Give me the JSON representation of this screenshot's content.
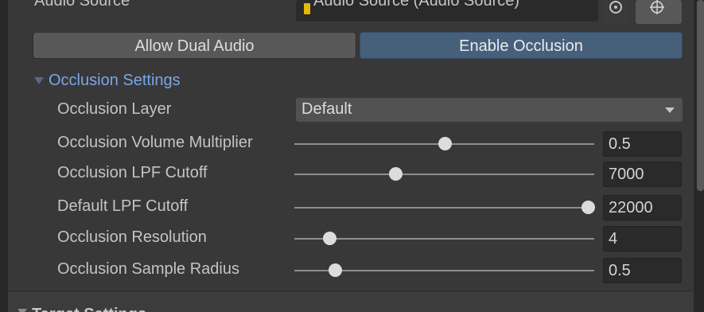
{
  "top": {
    "label": "Audio Source",
    "object_value": "Audio Source (Audio Source)",
    "object_icon": "audio-source-icon",
    "picker_icon": "object-picker-icon",
    "target_icon": "target-icon"
  },
  "buttons": {
    "dual_audio": "Allow Dual Audio",
    "enable_occlusion": "Enable Occlusion"
  },
  "occlusion_settings": {
    "title": "Occlusion Settings",
    "layer": {
      "label": "Occlusion Layer",
      "value": "Default"
    },
    "sliders": [
      {
        "label": "Occlusion Volume Multiplier",
        "value": "0.5",
        "fraction": 0.5
      },
      {
        "label": "Occlusion LPF Cutoff",
        "value": "7000",
        "fraction": 0.33
      },
      {
        "label": "Default LPF Cutoff",
        "value": "22000",
        "fraction": 1.0
      },
      {
        "label": "Occlusion Resolution",
        "value": "4",
        "fraction": 0.1
      },
      {
        "label": "Occlusion Sample Radius",
        "value": "0.5",
        "fraction": 0.12
      }
    ]
  },
  "next_section": {
    "title": "Target Settings"
  },
  "colors": {
    "accent_button": "#46607c",
    "foldout_title": "#7aa6e8",
    "panel_bg": "#383838"
  }
}
